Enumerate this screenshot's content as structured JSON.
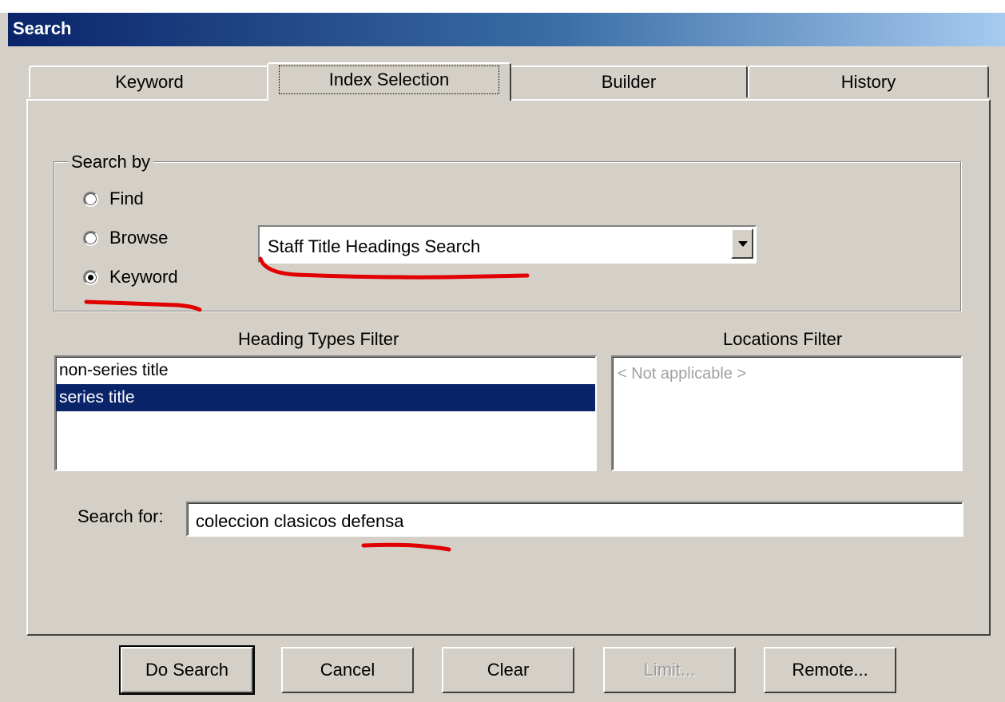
{
  "window": {
    "title": "Search"
  },
  "tabs": [
    {
      "label": "Keyword"
    },
    {
      "label": "Index Selection"
    },
    {
      "label": "Builder"
    },
    {
      "label": "History"
    }
  ],
  "search_by": {
    "label": "Search by",
    "options": [
      {
        "label": "Find",
        "checked": false
      },
      {
        "label": "Browse",
        "checked": false
      },
      {
        "label": "Keyword",
        "checked": true
      }
    ],
    "index_select_value": "Staff Title Headings Search"
  },
  "heading_types_filter": {
    "label": "Heading Types Filter",
    "items": [
      {
        "label": "non-series title",
        "selected": false
      },
      {
        "label": "series title",
        "selected": true
      }
    ]
  },
  "locations_filter": {
    "label": "Locations Filter",
    "placeholder": "< Not applicable >"
  },
  "search_for": {
    "label": "Search for:",
    "value": "coleccion clasicos defensa"
  },
  "buttons": {
    "do_search": "Do Search",
    "cancel": "Cancel",
    "clear": "Clear",
    "limit": "Limit...",
    "remote": "Remote..."
  },
  "colors": {
    "dialog_bg": "#d4d0c8",
    "title_bar": "#0a246a",
    "selection": "#0a246a",
    "annotation_red": "#e00000"
  }
}
